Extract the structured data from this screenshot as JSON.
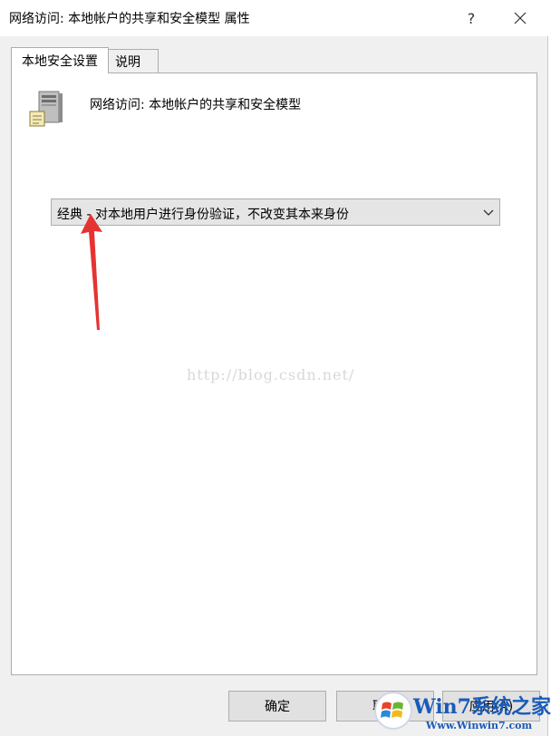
{
  "window": {
    "title": "网络访问: 本地帐户的共享和安全模型 属性",
    "help_label": "?"
  },
  "tabs": [
    {
      "label": "本地安全设置"
    },
    {
      "label": "说明"
    }
  ],
  "policy": {
    "name": "网络访问: 本地帐户的共享和安全模型",
    "selected_value": "经典 - 对本地用户进行身份验证，不改变其本来身份"
  },
  "watermark": "http://blog.csdn.net/",
  "buttons": {
    "ok": "确定",
    "cancel": "取消",
    "apply": "应用(A)"
  },
  "logo": {
    "main": "Win7系统之家",
    "sub": "Www.Winwin7.com"
  },
  "colors": {
    "annotation_arrow": "#e53333",
    "logo_blue": "#1a5bb8"
  },
  "icons": {
    "policy": "server-icon",
    "close": "close-icon",
    "dropdown": "chevron-down-icon"
  }
}
